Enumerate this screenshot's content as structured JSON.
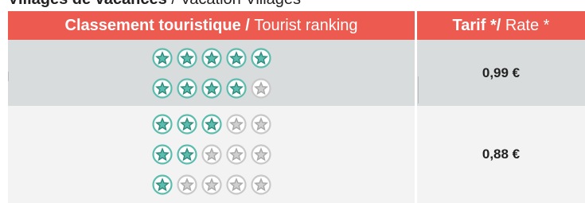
{
  "title": {
    "fr": "Villages de vacances",
    "separator": " / ",
    "en": "Vacation Villages"
  },
  "header": {
    "ranking_fr": "Classement touristique /",
    "ranking_en": "Tourist ranking",
    "rate_fr": "Tarif */",
    "rate_en": "Rate *"
  },
  "rows": [
    {
      "ratings": [
        5,
        4
      ],
      "rate": "0,99 €"
    },
    {
      "ratings": [
        3,
        2,
        1
      ],
      "rate": "0,88 €"
    }
  ],
  "max_stars": 5,
  "colors": {
    "header_bg": "#ec5a50",
    "star_on": "#5cbcae",
    "star_off": "#cfcfcf",
    "row_a_bg": "#d9dcdd",
    "row_b_bg": "#f3f3f3"
  },
  "icons": {
    "star_filled": "star-filled-icon",
    "star_empty": "star-empty-icon"
  }
}
